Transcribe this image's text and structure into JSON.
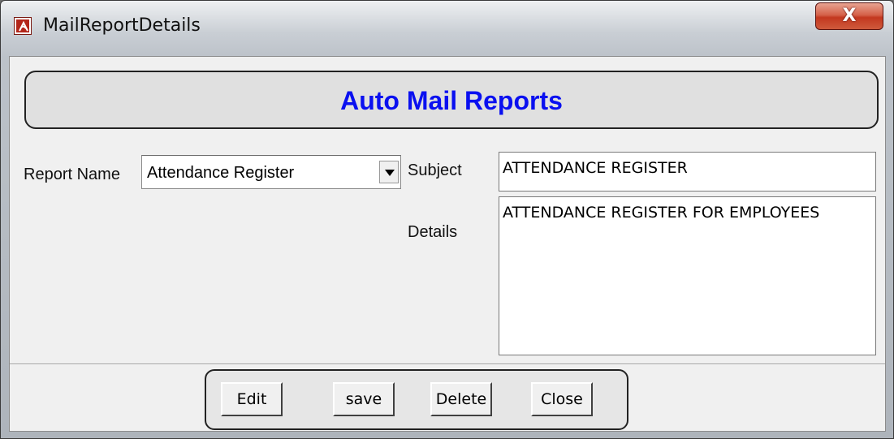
{
  "window": {
    "title": "MailReportDetails",
    "close_glyph": "X",
    "icon": "app-icon"
  },
  "header": {
    "title": "Auto Mail Reports",
    "title_color": "#0a10f0"
  },
  "form": {
    "report_name_label": "Report Name",
    "report_name_value": "Attendance Register",
    "subject_label": "Subject",
    "subject_value": "ATTENDANCE REGISTER",
    "details_label": "Details",
    "details_value": "ATTENDANCE REGISTER FOR EMPLOYEES"
  },
  "buttons": {
    "edit": "Edit",
    "save": "save",
    "delete": "Delete",
    "close": "Close"
  }
}
